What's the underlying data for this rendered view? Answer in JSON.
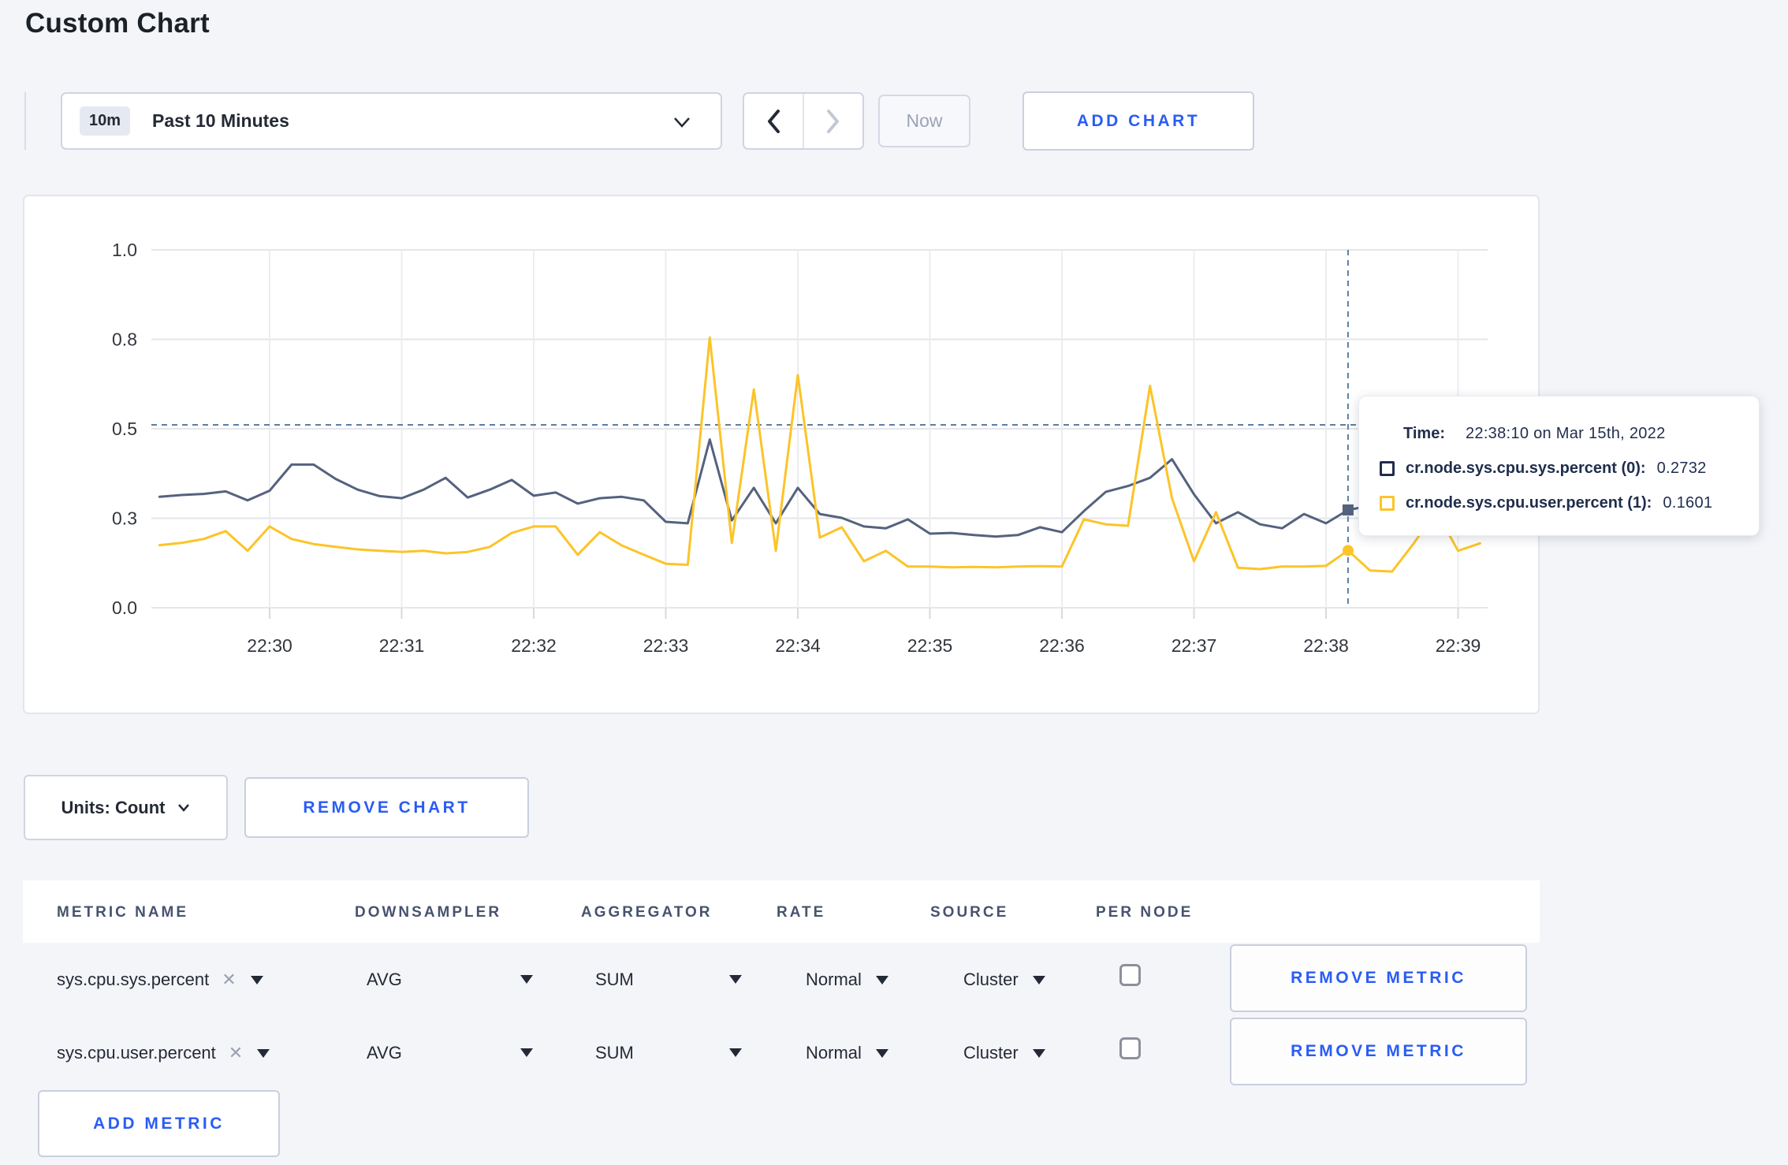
{
  "title": "Custom Chart",
  "toolbar": {
    "range_badge": "10m",
    "range_label": "Past 10 Minutes",
    "prev_label": "‹",
    "next_label": "›",
    "now_label": "Now",
    "add_chart_label": "ADD CHART"
  },
  "colors": {
    "sys_series": "#55627f",
    "user_series": "#fcc428",
    "accent_blue": "#2a5cf4",
    "grid_h": "#e5e6ea",
    "grid_v": "#ededf0",
    "crosshair": "#5d7ea0",
    "axis_text": "#33373d"
  },
  "chart_data": {
    "type": "line",
    "title": "",
    "xlabel": "",
    "ylabel": "",
    "ylim": [
      0,
      1
    ],
    "grid": true,
    "legend_position": "tooltip-only",
    "y_ticks": [
      {
        "v": 0.0,
        "label": "0.0"
      },
      {
        "v": 0.25,
        "label": "0.3"
      },
      {
        "v": 0.5,
        "label": "0.5"
      },
      {
        "v": 0.75,
        "label": "0.8"
      },
      {
        "v": 1.0,
        "label": "1.0"
      }
    ],
    "x_ticks": [
      "22:30",
      "22:31",
      "22:32",
      "22:33",
      "22:34",
      "22:35",
      "22:36",
      "22:37",
      "22:38",
      "22:39"
    ],
    "crosshair": {
      "time": "22:38:10",
      "y_value": 0.511
    },
    "series": [
      {
        "name": "cr.node.sys.cpu.sys.percent",
        "color": "#55627f",
        "marker": "square",
        "hover_value": 0.2732,
        "points": [
          [
            "22:29:10",
            0.31
          ],
          [
            "22:29:20",
            0.315
          ],
          [
            "22:29:30",
            0.318
          ],
          [
            "22:29:40",
            0.325
          ],
          [
            "22:29:50",
            0.3
          ],
          [
            "22:30:00",
            0.327
          ],
          [
            "22:30:10",
            0.4
          ],
          [
            "22:30:20",
            0.4
          ],
          [
            "22:30:30",
            0.36
          ],
          [
            "22:30:40",
            0.33
          ],
          [
            "22:30:50",
            0.312
          ],
          [
            "22:31:00",
            0.306
          ],
          [
            "22:31:10",
            0.33
          ],
          [
            "22:31:20",
            0.363
          ],
          [
            "22:31:30",
            0.308
          ],
          [
            "22:31:40",
            0.33
          ],
          [
            "22:31:50",
            0.357
          ],
          [
            "22:32:00",
            0.313
          ],
          [
            "22:32:10",
            0.322
          ],
          [
            "22:32:20",
            0.291
          ],
          [
            "22:32:30",
            0.306
          ],
          [
            "22:32:40",
            0.31
          ],
          [
            "22:32:50",
            0.3
          ],
          [
            "22:33:00",
            0.24
          ],
          [
            "22:33:10",
            0.236
          ],
          [
            "22:33:20",
            0.47
          ],
          [
            "22:33:30",
            0.244
          ],
          [
            "22:33:40",
            0.335
          ],
          [
            "22:33:50",
            0.236
          ],
          [
            "22:34:00",
            0.335
          ],
          [
            "22:34:10",
            0.262
          ],
          [
            "22:34:20",
            0.251
          ],
          [
            "22:34:30",
            0.227
          ],
          [
            "22:34:40",
            0.222
          ],
          [
            "22:34:50",
            0.247
          ],
          [
            "22:35:00",
            0.207
          ],
          [
            "22:35:10",
            0.209
          ],
          [
            "22:35:20",
            0.203
          ],
          [
            "22:35:30",
            0.199
          ],
          [
            "22:35:40",
            0.203
          ],
          [
            "22:35:50",
            0.225
          ],
          [
            "22:36:00",
            0.211
          ],
          [
            "22:36:10",
            0.27
          ],
          [
            "22:36:20",
            0.324
          ],
          [
            "22:36:30",
            0.34
          ],
          [
            "22:36:40",
            0.363
          ],
          [
            "22:36:50",
            0.415
          ],
          [
            "22:37:00",
            0.317
          ],
          [
            "22:37:10",
            0.236
          ],
          [
            "22:37:20",
            0.267
          ],
          [
            "22:37:30",
            0.233
          ],
          [
            "22:37:40",
            0.222
          ],
          [
            "22:37:50",
            0.262
          ],
          [
            "22:38:00",
            0.236
          ],
          [
            "22:38:10",
            0.2732
          ],
          [
            "22:38:20",
            0.285
          ],
          [
            "22:38:30",
            0.295
          ],
          [
            "22:38:40",
            0.3
          ],
          [
            "22:38:50",
            0.31
          ],
          [
            "22:39:00",
            0.295
          ],
          [
            "22:39:10",
            0.3
          ]
        ]
      },
      {
        "name": "cr.node.sys.cpu.user.percent",
        "color": "#fcc428",
        "marker": "circle",
        "hover_value": 0.1601,
        "points": [
          [
            "22:29:10",
            0.175
          ],
          [
            "22:29:20",
            0.181
          ],
          [
            "22:29:30",
            0.192
          ],
          [
            "22:29:40",
            0.214
          ],
          [
            "22:29:50",
            0.159
          ],
          [
            "22:30:00",
            0.227
          ],
          [
            "22:30:10",
            0.192
          ],
          [
            "22:30:20",
            0.178
          ],
          [
            "22:30:30",
            0.17
          ],
          [
            "22:30:40",
            0.163
          ],
          [
            "22:30:50",
            0.159
          ],
          [
            "22:31:00",
            0.156
          ],
          [
            "22:31:10",
            0.159
          ],
          [
            "22:31:20",
            0.152
          ],
          [
            "22:31:30",
            0.156
          ],
          [
            "22:31:40",
            0.17
          ],
          [
            "22:31:50",
            0.209
          ],
          [
            "22:32:00",
            0.227
          ],
          [
            "22:32:10",
            0.227
          ],
          [
            "22:32:20",
            0.148
          ],
          [
            "22:32:30",
            0.211
          ],
          [
            "22:32:40",
            0.174
          ],
          [
            "22:32:50",
            0.148
          ],
          [
            "22:33:00",
            0.123
          ],
          [
            "22:33:10",
            0.12
          ],
          [
            "22:33:20",
            0.755
          ],
          [
            "22:33:30",
            0.181
          ],
          [
            "22:33:40",
            0.61
          ],
          [
            "22:33:50",
            0.159
          ],
          [
            "22:34:00",
            0.65
          ],
          [
            "22:34:10",
            0.196
          ],
          [
            "22:34:20",
            0.225
          ],
          [
            "22:34:30",
            0.13
          ],
          [
            "22:34:40",
            0.159
          ],
          [
            "22:34:50",
            0.115
          ],
          [
            "22:35:00",
            0.115
          ],
          [
            "22:35:10",
            0.113
          ],
          [
            "22:35:20",
            0.114
          ],
          [
            "22:35:30",
            0.113
          ],
          [
            "22:35:40",
            0.115
          ],
          [
            "22:35:50",
            0.116
          ],
          [
            "22:36:00",
            0.115
          ],
          [
            "22:36:10",
            0.247
          ],
          [
            "22:36:20",
            0.233
          ],
          [
            "22:36:30",
            0.229
          ],
          [
            "22:36:40",
            0.62
          ],
          [
            "22:36:50",
            0.306
          ],
          [
            "22:37:00",
            0.13
          ],
          [
            "22:37:10",
            0.267
          ],
          [
            "22:37:20",
            0.112
          ],
          [
            "22:37:30",
            0.108
          ],
          [
            "22:37:40",
            0.115
          ],
          [
            "22:37:50",
            0.115
          ],
          [
            "22:38:00",
            0.117
          ],
          [
            "22:38:10",
            0.1601
          ],
          [
            "22:38:20",
            0.104
          ],
          [
            "22:38:30",
            0.101
          ],
          [
            "22:38:40",
            0.181
          ],
          [
            "22:38:50",
            0.27
          ],
          [
            "22:39:00",
            0.159
          ],
          [
            "22:39:10",
            0.18
          ]
        ]
      }
    ]
  },
  "tooltip": {
    "time_label": "Time:",
    "time_value": "22:38:10 on Mar 15th, 2022",
    "rows": [
      {
        "name": "cr.node.sys.cpu.sys.percent (0):",
        "value": "0.2732"
      },
      {
        "name": "cr.node.sys.cpu.user.percent (1):",
        "value": "0.1601"
      }
    ]
  },
  "units_row": {
    "units_label": "Units: Count",
    "remove_chart_label": "REMOVE CHART"
  },
  "metrics_table": {
    "headers": [
      "METRIC NAME",
      "DOWNSAMPLER",
      "AGGREGATOR",
      "RATE",
      "SOURCE",
      "PER NODE"
    ],
    "rows": [
      {
        "metric": "sys.cpu.sys.percent",
        "close": "✕",
        "downsampler": "AVG",
        "aggregator": "SUM",
        "rate": "Normal",
        "source": "Cluster",
        "per_node_checked": false,
        "remove_label": "REMOVE METRIC"
      },
      {
        "metric": "sys.cpu.user.percent",
        "close": "✕",
        "downsampler": "AVG",
        "aggregator": "SUM",
        "rate": "Normal",
        "source": "Cluster",
        "per_node_checked": false,
        "remove_label": "REMOVE METRIC"
      }
    ],
    "add_metric_label": "ADD METRIC"
  }
}
